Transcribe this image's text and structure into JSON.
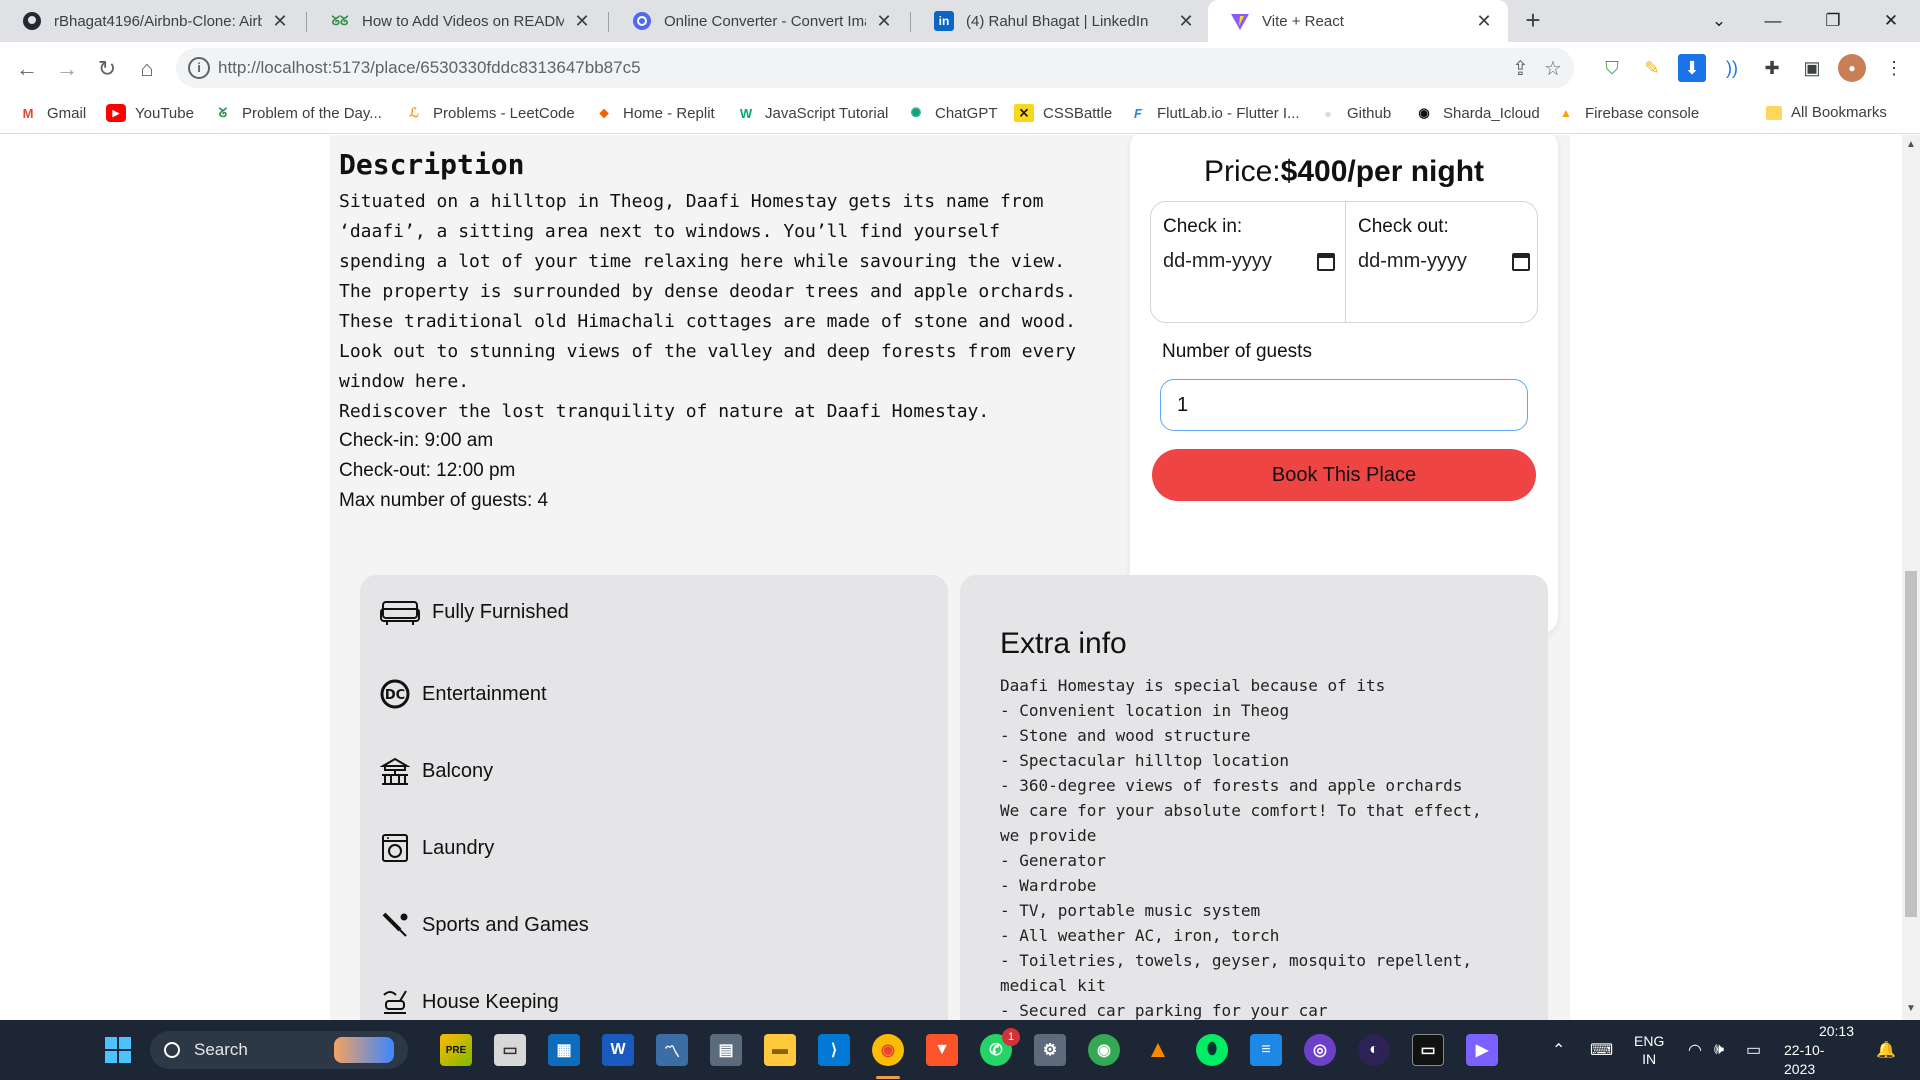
{
  "browser": {
    "tabs": [
      {
        "title": "rBhagat4196/Airbnb-Clone: Airb",
        "favicon": "github-icon",
        "color": "#24292f"
      },
      {
        "title": "How to Add Videos on README",
        "favicon": "gfg-icon",
        "color": "#2f8d46"
      },
      {
        "title": "Online Converter - Convert Imag",
        "favicon": "converter-icon",
        "color": "#4f6bed"
      },
      {
        "title": "(4) Rahul Bhagat | LinkedIn",
        "favicon": "linkedin-icon",
        "color": "#0a66c2"
      },
      {
        "title": "Vite + React",
        "favicon": "vite-icon",
        "color": "#8b5cf6"
      }
    ],
    "new_tab": "+",
    "url": "http://localhost:5173/place/6530330fddc8313647bb87c5",
    "bookmarks": [
      {
        "label": "Gmail",
        "icon": "gmail-icon",
        "color": "#ea4335",
        "glyph": "M"
      },
      {
        "label": "YouTube",
        "icon": "youtube-icon",
        "color": "#ff0000",
        "glyph": "▶"
      },
      {
        "label": "Problem of the Day...",
        "icon": "gfg-icon",
        "color": "#2f8d46",
        "glyph": "ᘜ"
      },
      {
        "label": "Problems - LeetCode",
        "icon": "leetcode-icon",
        "color": "#f89f1b",
        "glyph": "ℒ"
      },
      {
        "label": "Home - Replit",
        "icon": "replit-icon",
        "color": "#f26207",
        "glyph": "⬥"
      },
      {
        "label": "JavaScript Tutorial",
        "icon": "w3schools-icon",
        "color": "#04aa6d",
        "glyph": "W"
      },
      {
        "label": "ChatGPT",
        "icon": "chatgpt-icon",
        "color": "#10a37f",
        "glyph": "✺"
      },
      {
        "label": "CSSBattle",
        "icon": "cssbattle-icon",
        "color": "#f9d71c",
        "glyph": "⨯"
      },
      {
        "label": "FlutLab.io - Flutter I...",
        "icon": "flutlab-icon",
        "color": "#1e88e5",
        "glyph": "F"
      },
      {
        "label": "Github",
        "icon": "github-icon",
        "color": "#24292f",
        "glyph": "●"
      },
      {
        "label": "Sharda_Icloud",
        "icon": "sharda-icon",
        "color": "#111111",
        "glyph": "◉"
      },
      {
        "label": "Firebase console",
        "icon": "firebase-icon",
        "color": "#ffa000",
        "glyph": "🔥"
      }
    ],
    "all_bookmarks": "All Bookmarks"
  },
  "page": {
    "description_title": "Description",
    "description": "Situated on a hilltop in Theog, Daafi Homestay gets its name from\n‘daafi’, a sitting area next to windows. You’ll find yourself\nspending a lot of your time relaxing here while savouring the view.\nThe property is surrounded by dense deodar trees and apple orchards.\nThese traditional old Himachali cottages are made of stone and wood.\nLook out to stunning views of the valley and deep forests from every\nwindow here.\nRediscover the lost tranquility of nature at Daafi Homestay.",
    "check_in": "Check-in: 9:00 am",
    "check_out": "Check-out: 12:00 pm",
    "max_guests": "Max number of guests: 4",
    "booking": {
      "price_prefix": "Price:",
      "price_value": "$400/per night",
      "check_in_label": "Check in:",
      "check_out_label": "Check out:",
      "date_placeholder": "dd-mm-yyyy",
      "guests_label": "Number of guests",
      "guests_value": "1",
      "book_button": "Book This Place",
      "accent": "#ef4444"
    },
    "perks": [
      {
        "label": "Fully Furnished",
        "icon": "sofa-icon"
      },
      {
        "label": "Entertainment",
        "icon": "dc-icon"
      },
      {
        "label": "Balcony",
        "icon": "balcony-icon"
      },
      {
        "label": "Laundry",
        "icon": "washing-machine-icon"
      },
      {
        "label": "Sports and Games",
        "icon": "badminton-icon"
      },
      {
        "label": "House Keeping",
        "icon": "cleaning-icon"
      }
    ],
    "extra_title": "Extra info",
    "extra_info": "Daafi Homestay is special because of its\n- Convenient location in Theog\n- Stone and wood structure\n- Spectacular hilltop location\n- 360-degree views of forests and apple orchards\nWe care for your absolute comfort! To that effect,\nwe provide\n- Generator\n- Wardrobe\n- TV, portable music system\n- All weather AC, iron, torch\n- Toiletries, towels, geyser, mosquito repellent,\nmedical kit\n- Secured car parking for your car"
  },
  "taskbar": {
    "search_placeholder": "Search",
    "language": "ENG",
    "region": "IN",
    "time": "20:13",
    "date": "22-10-2023",
    "whatsapp_badge": "1"
  }
}
